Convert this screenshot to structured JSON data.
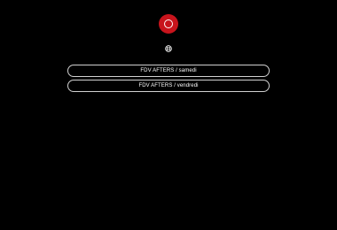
{
  "profile": {
    "logo_icon": "red-circle-ring-logo",
    "accent_color": "#c8141c"
  },
  "language": {
    "icon": "globe-icon"
  },
  "links": [
    {
      "label": "FDV AFTERS / samedi"
    },
    {
      "label": "FDV AFTERS / vendredi"
    }
  ]
}
